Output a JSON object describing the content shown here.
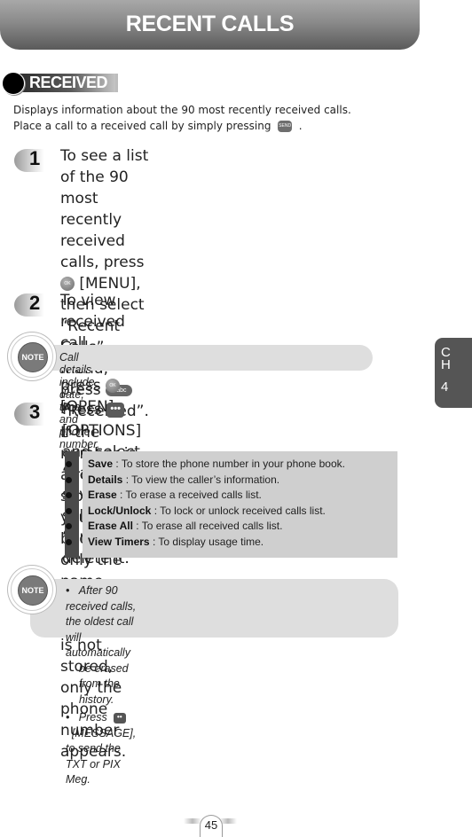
{
  "header": {
    "title": "RECENT CALLS"
  },
  "section_tag": {
    "label": "RECEIVED"
  },
  "intro": {
    "line1": "Displays information about the 90 most recently received calls.",
    "line2_before": "Place a call to a received call by simply pressing",
    "line2_after": ".",
    "send_key_label": "SEND"
  },
  "keys": {
    "ok": "OK",
    "two": "2 abc",
    "options": "•••",
    "message": "••"
  },
  "steps": [
    {
      "number": "1",
      "lines": [
        {
          "a": "To see a list of the 90 most recently received"
        },
        {
          "a": "calls, press",
          "b": "[MENU], then select “Recent"
        },
        {
          "a": "Calls” menu, press",
          "b": "“Received”. If the"
        },
        {
          "a": "number is already stored in your phone book,"
        },
        {
          "a": "only the name appears. If the number is not"
        },
        {
          "a": "stored, only the phone number appears."
        }
      ]
    },
    {
      "number": "2",
      "before": "To view received call details, press",
      "after": "[OPEN]."
    },
    {
      "number": "3",
      "line1_before": "Press",
      "line1_after": "[OPTIONS] and select “Save” to",
      "line2": "save it or select “Erase” to delete it."
    }
  ],
  "note1": {
    "icon_label": "NOTE",
    "text": "Call details include date, time and phone number."
  },
  "options": [
    {
      "term": "Save",
      "desc": " : To store the phone number in your phone book."
    },
    {
      "term": "Details",
      "desc": " : To view the caller’s information."
    },
    {
      "term": "Erase",
      "desc": " : To erase a received calls list."
    },
    {
      "term": "Lock/Unlock",
      "desc": " : To lock or unlock received calls list."
    },
    {
      "term": "Erase All",
      "desc": " : To erase all received calls list."
    },
    {
      "term": "View Timers",
      "desc": " : To display usage time."
    }
  ],
  "note2": {
    "icon_label": "NOTE",
    "bullet1_line1": "After 90 received calls, the oldest call will automatically",
    "bullet1_line2": "be erased from the history.",
    "bullet2_before": "Press",
    "bullet2_after": "[MESSAGE], to send the TXT or PIX Meg."
  },
  "chapter_tab": {
    "c": "C",
    "h": "H",
    "num": "4"
  },
  "page_number": "45"
}
